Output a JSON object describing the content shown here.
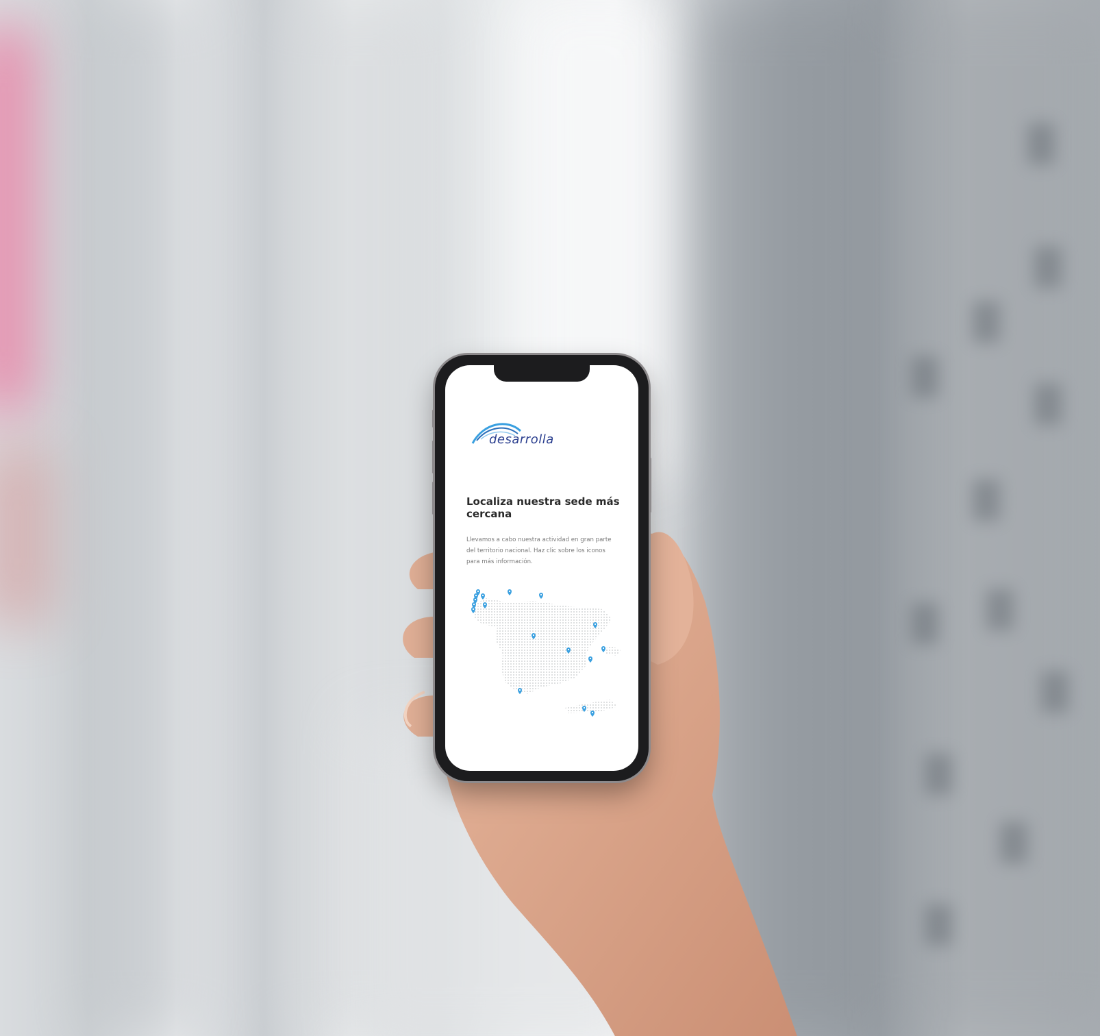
{
  "app": {
    "brand": "desarrolla",
    "brand_color": "#2b3f8f",
    "accent_color": "#3aa0e0"
  },
  "page": {
    "title": "Localiza nuestra sede más cercana",
    "description": "Llevamos a cabo nuestra actividad en gran parte del territorio nacional. Haz clic sobre los iconos para más información."
  },
  "map": {
    "icon": "location-pin-icon",
    "region": "spain-dotted-map"
  }
}
